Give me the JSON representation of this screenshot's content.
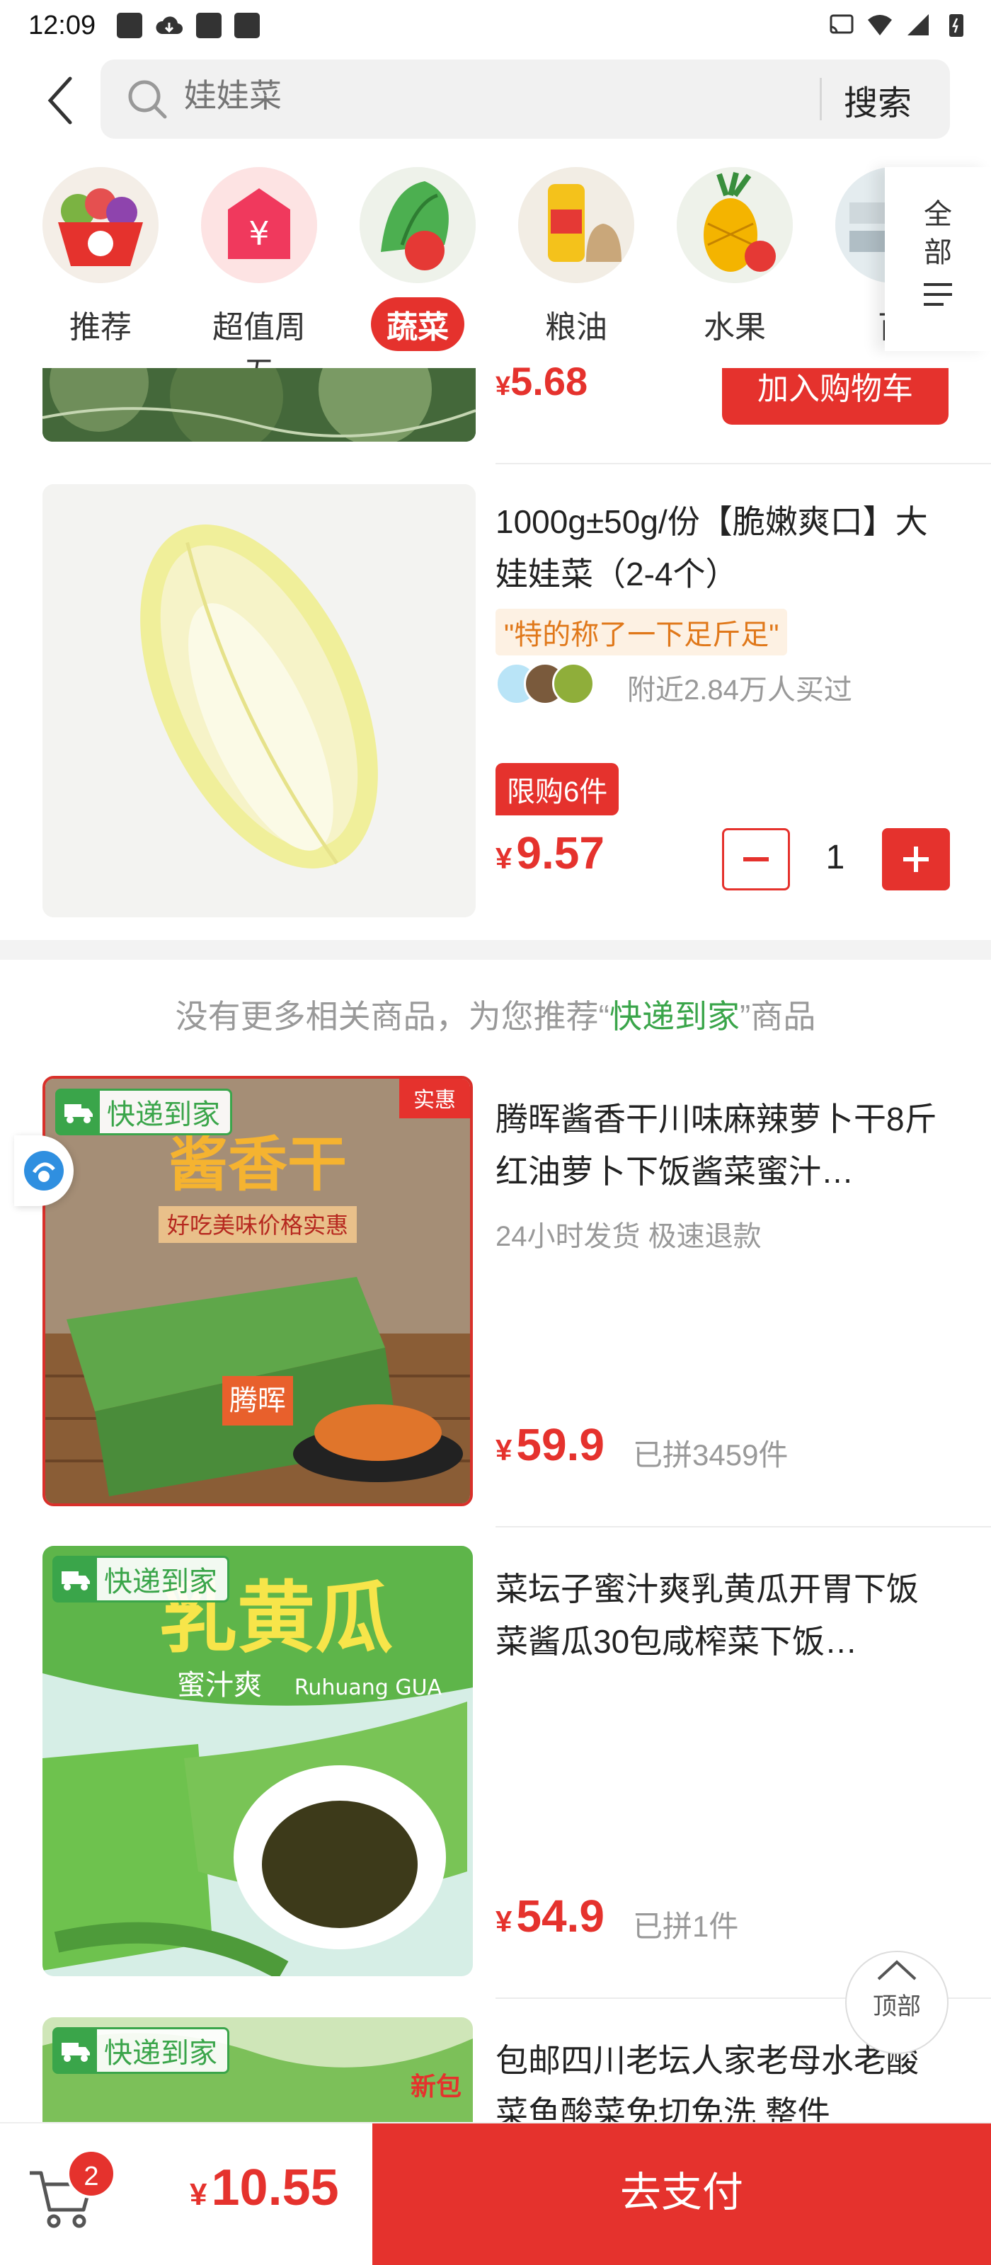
{
  "status_bar": {
    "time": "12:09"
  },
  "header": {
    "search_placeholder": "娃娃菜",
    "search_button": "搜索"
  },
  "categories": [
    {
      "label": "推荐",
      "active": false
    },
    {
      "label": "超值周五",
      "active": false
    },
    {
      "label": "蔬菜",
      "active": true
    },
    {
      "label": "粮油",
      "active": false
    },
    {
      "label": "水果",
      "active": false
    },
    {
      "label": "百",
      "active": false
    }
  ],
  "all_button": "全部",
  "product_prev": {
    "price_symbol": "¥",
    "price": "5.68",
    "button": "加入购物车"
  },
  "product_main": {
    "title": "1000g±50g/份【脆嫩爽口】大娃娃菜（2-4个）",
    "tag": "\"特的称了一下足斤足\"",
    "bought": "附近2.84万人买过",
    "limit": "限购6件",
    "price_symbol": "¥",
    "price": "9.57",
    "quantity": "1"
  },
  "recommend": {
    "prefix": "没有更多相关商品，为您推荐“",
    "highlight": "快递到家",
    "suffix": "”商品"
  },
  "recommend_items": [
    {
      "badge": "快递到家",
      "title": "腾晖酱香干川味麻辣萝卜干8斤红油萝卜下饭酱菜蜜汁…",
      "meta": "24小时发货   极速退款",
      "price_symbol": "¥",
      "price": "59.9",
      "sold": "已拼3459件",
      "image_text": {
        "corner": "实惠",
        "headline": "酱香干",
        "sub": "好吃美味价格实惠",
        "brand": "腾晖"
      }
    },
    {
      "badge": "快递到家",
      "title": "菜坛子蜜汁爽乳黄瓜开胃下饭菜酱瓜30包咸榨菜下饭…",
      "meta": "",
      "price_symbol": "¥",
      "price": "54.9",
      "sold": "已拼1件",
      "image_text": {
        "headline": "乳黄瓜",
        "sub": "蜜汁爽",
        "en": "Ruhuang GUA"
      }
    },
    {
      "badge": "快递到家",
      "title": "包邮四川老坛人家老母水老酸菜鱼酸菜免切免洗 整件",
      "image_text": {
        "corner": "新包"
      }
    }
  ],
  "top_button": "顶部",
  "bottom": {
    "cart_count": "2",
    "price_symbol": "¥",
    "total": "10.55",
    "pay": "去支付"
  },
  "colors": {
    "accent": "#e5322d",
    "green": "#3aa54a",
    "tag_orange": "#e0781a"
  }
}
